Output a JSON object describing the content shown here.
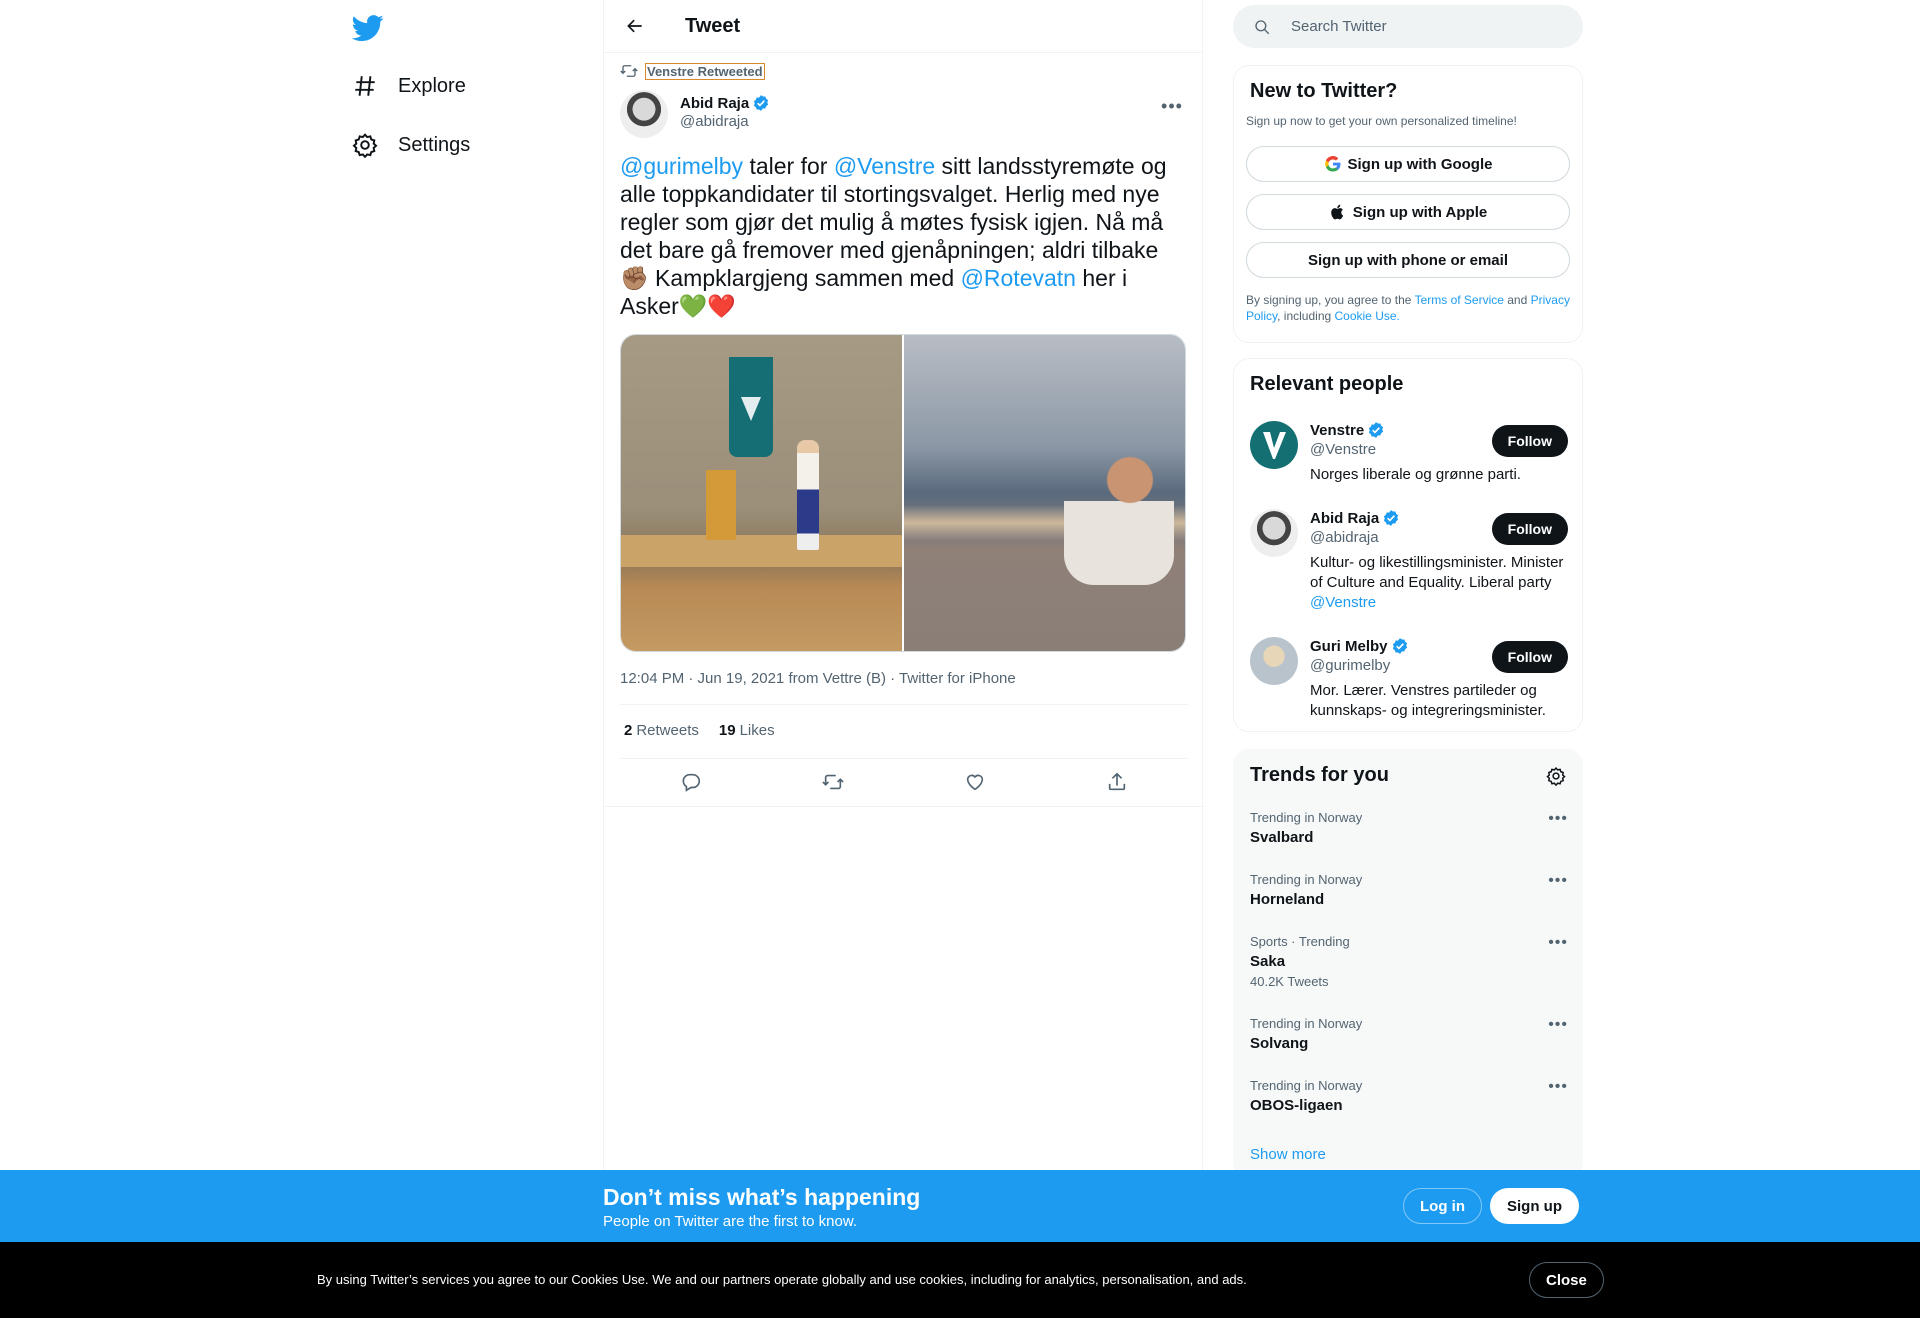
{
  "nav": {
    "explore": "Explore",
    "settings": "Settings"
  },
  "header": {
    "title": "Tweet"
  },
  "tweet": {
    "retweeted_by": "Venstre Retweeted",
    "author_name": "Abid Raja",
    "author_handle": "@abidraja",
    "text": {
      "m1": "@gurimelby",
      "t1": " taler for ",
      "m2": "@Venstre",
      "t2": " sitt landsstyremøte og alle toppkandidater til stortingsvalget. Herlig med nye regler som gjør det mulig å møtes fysisk igjen. Nå må det bare gå fremover med gjenåpningen; aldri tilbake✊🏽 Kampklargjeng sammen med ",
      "m3": "@Rotevatn",
      "t3": " her i Asker💚❤️"
    },
    "meta": "12:04 PM · Jun 19, 2021 from Vettre (B) · Twitter for iPhone",
    "retweets_count": "2",
    "retweets_label": "Retweets",
    "likes_count": "19",
    "likes_label": "Likes"
  },
  "search": {
    "placeholder": "Search Twitter"
  },
  "signup_panel": {
    "title": "New to Twitter?",
    "subtitle": "Sign up now to get your own personalized timeline!",
    "google": "Sign up with Google",
    "apple": "Sign up with Apple",
    "phone": "Sign up with phone or email",
    "terms_1": "By signing up, you agree to the ",
    "terms_link1": "Terms of Service",
    "terms_2": " and ",
    "terms_link2": "Privacy Policy",
    "terms_3": ", including ",
    "terms_link3": "Cookie Use."
  },
  "relevant": {
    "title": "Relevant people",
    "follow_label": "Follow",
    "people": [
      {
        "name": "Venstre",
        "handle": "@Venstre",
        "bio": "Norges liberale og grønne parti."
      },
      {
        "name": "Abid Raja",
        "handle": "@abidraja",
        "bio": "Kultur- og likestillingsminister. Minister of Culture and Equality. Liberal party ",
        "bio_link": "@Venstre"
      },
      {
        "name": "Guri Melby",
        "handle": "@gurimelby",
        "bio": "Mor. Lærer. Venstres partileder og kunnskaps- og integreringsminister."
      }
    ]
  },
  "trends": {
    "title": "Trends for you",
    "items": [
      {
        "context": "Trending in Norway",
        "name": "Svalbard"
      },
      {
        "context": "Trending in Norway",
        "name": "Horneland"
      },
      {
        "context": "Sports · Trending",
        "name": "Saka",
        "count": "40.2K Tweets"
      },
      {
        "context": "Trending in Norway",
        "name": "Solvang"
      },
      {
        "context": "Trending in Norway",
        "name": "OBOS-ligaen"
      }
    ],
    "show_more": "Show more"
  },
  "bottom_bar": {
    "title": "Don’t miss what’s happening",
    "subtitle": "People on Twitter are the first to know.",
    "login": "Log in",
    "signup": "Sign up"
  },
  "cookie": {
    "text": "By using Twitter’s services you agree to our Cookies Use. We and our partners operate globally and use cookies, including for analytics, personalisation, and ads.",
    "close": "Close"
  },
  "colors": {
    "accent": "#1d9bf0",
    "text": "#0f1419",
    "muted": "#536471"
  }
}
